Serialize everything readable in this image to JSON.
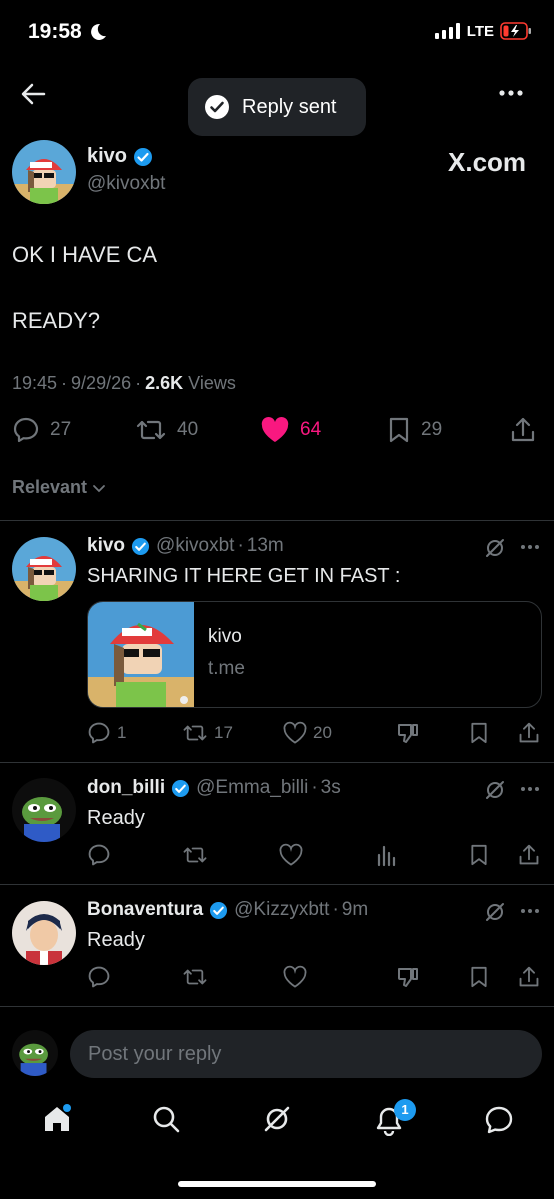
{
  "status_bar": {
    "time": "19:58",
    "network": "LTE"
  },
  "toast": {
    "text": "Reply sent"
  },
  "post": {
    "author_name": "kivo",
    "author_handle": "@kivoxbt",
    "site_label": "X.com",
    "text_line1": "OK I HAVE CA",
    "text_line2": "READY?",
    "time": "19:45",
    "date": "9/29/26",
    "views_count": "2.6K",
    "views_label": "Views",
    "replies": "27",
    "reposts": "40",
    "likes": "64",
    "bookmarks": "29"
  },
  "sort": {
    "label": "Relevant"
  },
  "replies": [
    {
      "name": "kivo",
      "handle": "@kivoxbt",
      "time": "13m",
      "text": "SHARING IT HERE GET IN FAST :",
      "link_title": "kivo",
      "link_domain": "t.me",
      "replies": "1",
      "reposts": "17",
      "likes": "20"
    },
    {
      "name": "don_billi",
      "handle": "@Emma_billi",
      "time": "3s",
      "text": "Ready"
    },
    {
      "name": "Bonaventura",
      "handle": "@Kizzyxbtt",
      "time": "9m",
      "text": "Ready"
    }
  ],
  "compose": {
    "placeholder": "Post your reply"
  },
  "tabbar": {
    "notifications_badge": "1"
  },
  "colors": {
    "background": "#000000",
    "accent": "#1d9bf0",
    "like": "#f91880",
    "muted": "#71767b"
  }
}
